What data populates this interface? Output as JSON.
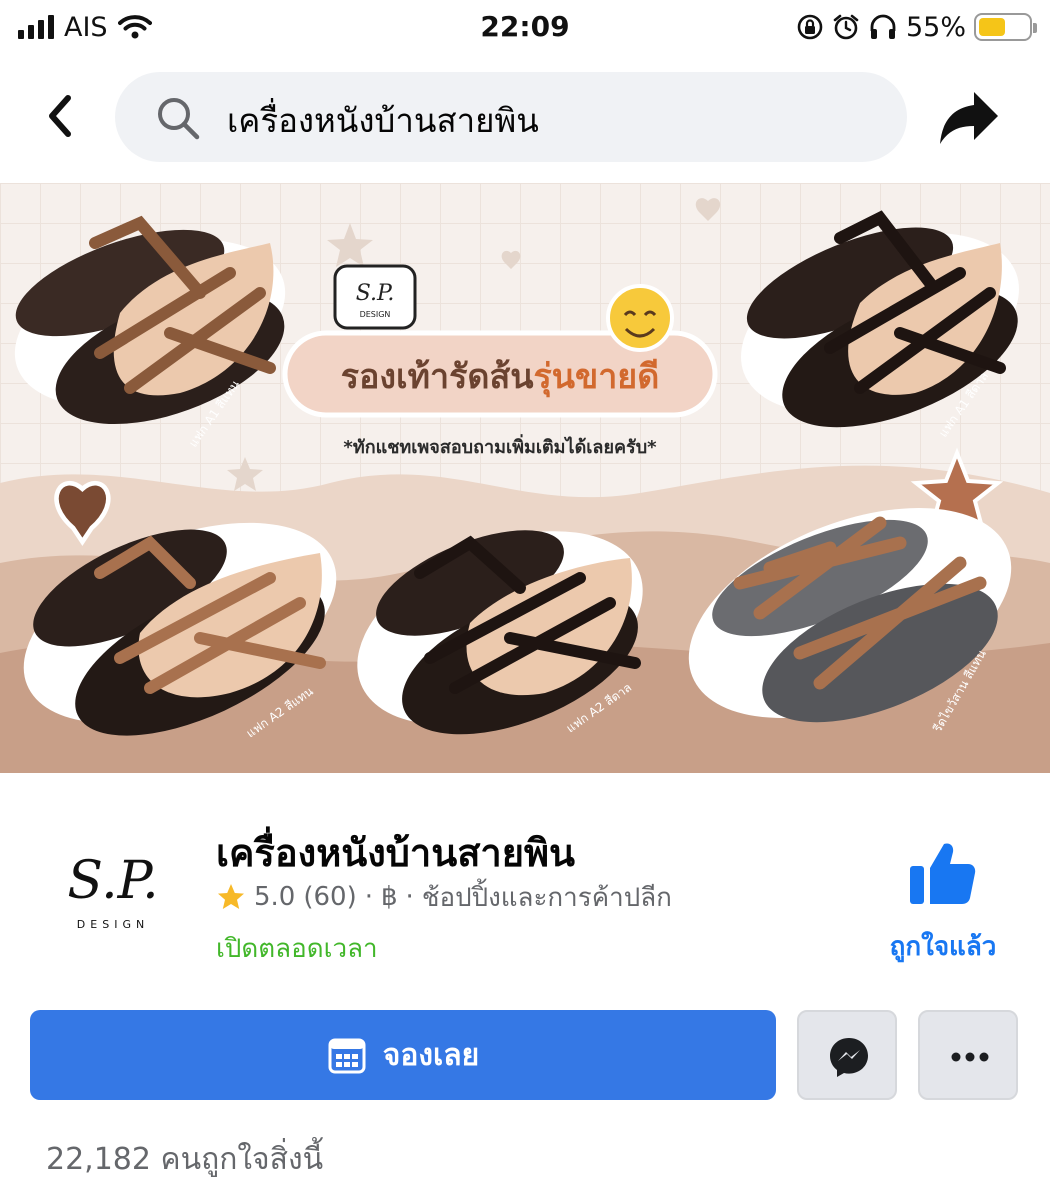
{
  "status_bar": {
    "carrier": "AIS",
    "time": "22:09",
    "battery_percent": "55%",
    "battery_level": 0.55,
    "battery_color": "#f5c518"
  },
  "header": {
    "back_icon": "chevron-left-icon",
    "search_icon": "search-icon",
    "search_query": "เครื่องหนังบ้านสายพิน",
    "share_icon": "share-arrow-icon"
  },
  "cover": {
    "logo_text": "S.P.",
    "logo_sub": "DESIGN",
    "headline_part1": "รองเท้ารัดส้น",
    "headline_part2": "รุ่นขายดี",
    "tagline": "*ทักแชทเพจสอบถามเพิ่มเติมได้เลยครับ*",
    "product_labels": [
      "แฟก A1 สีแทน",
      "แฟก A1 สีดาล",
      "แฟก A2 สีแทน",
      "แฟก A2 สีดาล",
      "รีดไขว้สาน สีแทน"
    ]
  },
  "page": {
    "avatar_text": "S.P.",
    "avatar_sub": "DESIGN",
    "name": "เครื่องหนังบ้านสายพิน",
    "rating": "5.0",
    "review_count": "(60)",
    "price_symbol": "฿",
    "category": "ช้อปปิ้งและการค้าปลีก",
    "separator": "·",
    "open_status": "เปิดตลอดเวลา",
    "like_label": "ถูกใจแล้ว",
    "accent_green": "#42b72a",
    "accent_blue": "#1877f2"
  },
  "actions": {
    "book_label": "จองเลย",
    "book_icon": "calendar-icon",
    "messenger_icon": "messenger-icon",
    "more_icon": "more-dots-icon",
    "button_color": "#3578e5"
  },
  "likes_count_text": "22,182 คนถูกใจสิ่งนี้"
}
